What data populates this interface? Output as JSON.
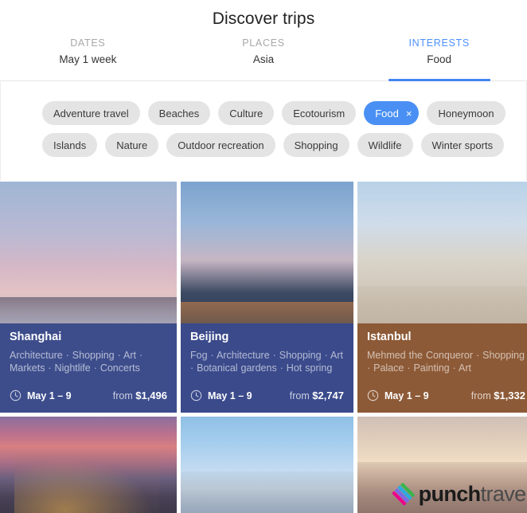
{
  "header": {
    "title": "Discover trips",
    "tabs": [
      {
        "label": "DATES",
        "value": "May 1 week",
        "active": false
      },
      {
        "label": "PLACES",
        "value": "Asia",
        "active": false
      },
      {
        "label": "INTERESTS",
        "value": "Food",
        "active": true
      }
    ]
  },
  "filters": {
    "rows": [
      [
        {
          "label": "Adventure travel",
          "selected": false
        },
        {
          "label": "Beaches",
          "selected": false
        },
        {
          "label": "Culture",
          "selected": false
        },
        {
          "label": "Ecotourism",
          "selected": false
        },
        {
          "label": "Food",
          "selected": true,
          "close": "×"
        },
        {
          "label": "Honeymoon",
          "selected": false
        }
      ],
      [
        {
          "label": "Islands",
          "selected": false
        },
        {
          "label": "Nature",
          "selected": false
        },
        {
          "label": "Outdoor recreation",
          "selected": false
        },
        {
          "label": "Shopping",
          "selected": false
        },
        {
          "label": "Wildlife",
          "selected": false
        },
        {
          "label": "Winter sports",
          "selected": false
        }
      ]
    ]
  },
  "cards": [
    {
      "title": "Shanghai",
      "tags": "Architecture · Shopping · Art · Markets · Nightlife · Concerts",
      "dates": "May 1 – 9",
      "price_prefix": "from ",
      "price": "$1,496",
      "bg_color": "#3d4d8c",
      "photo": "shanghai-skyline-photo"
    },
    {
      "title": "Beijing",
      "tags": "Fog · Architecture · Shopping · Art · Botanical gardens · Hot spring",
      "dates": "May 1 – 9",
      "price_prefix": "from ",
      "price": "$2,747",
      "bg_color": "#3a4a8b",
      "photo": "beijing-cctv-building-photo"
    },
    {
      "title": "Istanbul",
      "tags": "Mehmed the Conqueror · Shopping · Palace · Painting · Art",
      "dates": "May 1 – 9",
      "price_prefix": "from ",
      "price": "$1,332",
      "bg_color": "#8d5a37",
      "photo": "istanbul-mosque-domes-photo"
    },
    {
      "photo": "bangkok-temple-sunset-photo"
    },
    {
      "photo": "city-skyline-blue-sky-photo"
    },
    {
      "photo": "hong-kong-harbour-photo"
    }
  ],
  "watermark": {
    "brand_bold": "punch",
    "brand_light": "travel"
  },
  "colors": {
    "accent": "#4285f4",
    "tab_inactive": "#a8a8a8",
    "chip_bg": "#e4e4e4",
    "chip_selected": "#4a90f4"
  }
}
